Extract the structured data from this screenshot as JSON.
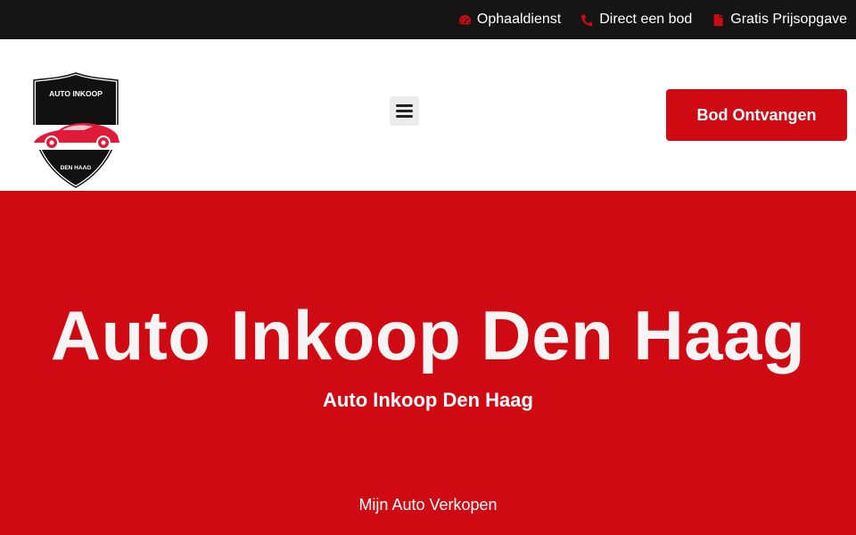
{
  "colors": {
    "accent": "#cf0a12",
    "topbar_bg": "#151515",
    "text_light": "#ffffff"
  },
  "topbar": {
    "items": [
      {
        "label": "Ophaaldienst",
        "icon": "speedometer-icon"
      },
      {
        "label": "Direct een bod",
        "icon": "phone-icon"
      },
      {
        "label": "Gratis Prijsopgave",
        "icon": "document-icon"
      }
    ]
  },
  "header": {
    "logo": {
      "top_text": "AUTO INKOOP",
      "bottom_text": "DEN HAAG",
      "icon": "car-shield-logo"
    },
    "menu_icon": "hamburger-menu-icon",
    "cta_label": "Bod Ontvangen"
  },
  "hero": {
    "title": "Auto Inkoop Den Haag",
    "subtitle": "Auto Inkoop Den Haag",
    "link_label": "Mijn Auto Verkopen"
  }
}
